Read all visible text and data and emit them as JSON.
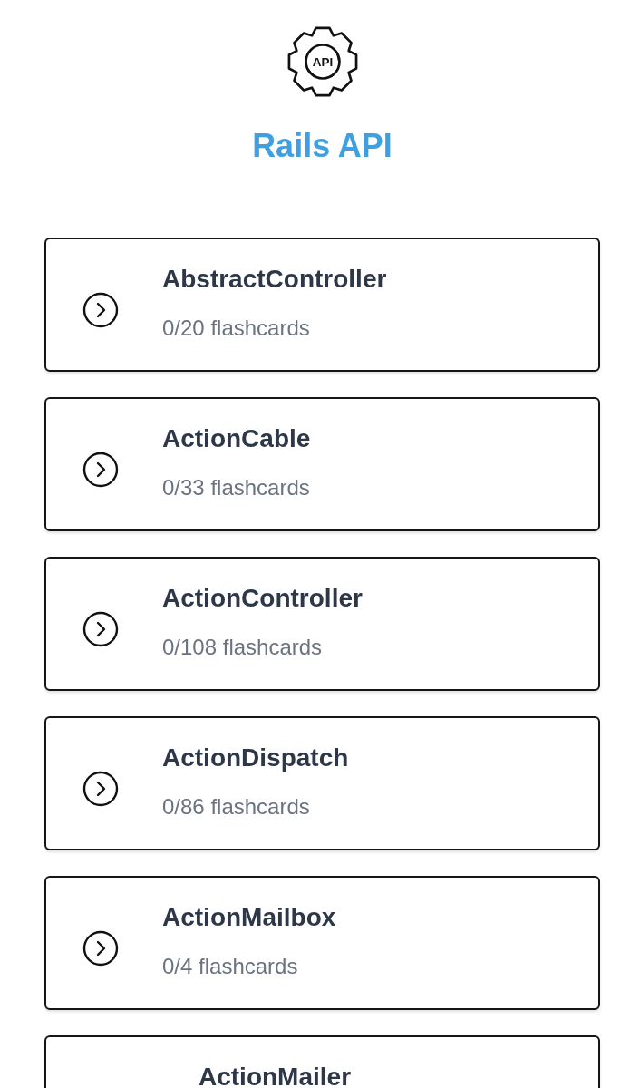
{
  "logo": {
    "text": "API"
  },
  "title": "Rails API",
  "topics": [
    {
      "name": "AbstractController",
      "count": "0/20 flashcards"
    },
    {
      "name": "ActionCable",
      "count": "0/33 flashcards"
    },
    {
      "name": "ActionController",
      "count": "0/108 flashcards"
    },
    {
      "name": "ActionDispatch",
      "count": "0/86 flashcards"
    },
    {
      "name": "ActionMailbox",
      "count": "0/4 flashcards"
    },
    {
      "name": "ActionMailer"
    }
  ]
}
